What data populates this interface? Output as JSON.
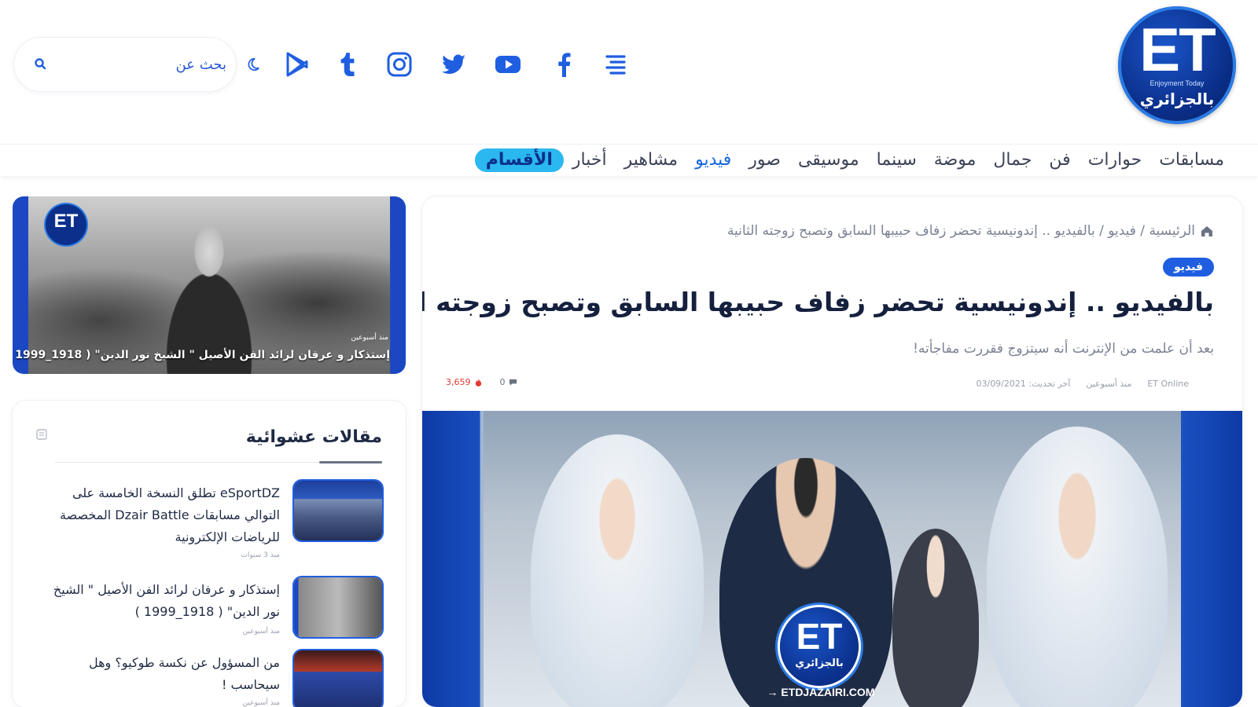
{
  "site": {
    "logo_text": "ET",
    "logo_tagline": "Enjoyment Today",
    "logo_arabic": "بالجزائري"
  },
  "search": {
    "placeholder": "بحث عن"
  },
  "nav": {
    "categories_label": "الأقسام",
    "items": [
      "أخبار",
      "مشاهير",
      "فيديو",
      "صور",
      "موسيقى",
      "سينما",
      "موضة",
      "جمال",
      "فن",
      "حوارات",
      "مسابقات"
    ],
    "active": "فيديو"
  },
  "article": {
    "breadcrumb": "الرئيسية / فيديو / بالفيديو .. إندونيسية تحضر زفاف حبيبها السابق وتصبح زوجته الثانية",
    "badge": "فيديو",
    "title": "بالفيديو .. إندونيسية تحضر زفاف حبيبها السابق وتصبح زوجته الثانية",
    "subtitle": "بعد أن علمت من الإنترنت أنه سيتزوج فقررت مفاجأته!",
    "meta_author": "ET Online",
    "meta_updated": "منذ أسبوعين",
    "meta_date": "آخر تحديث: 03/09/2021",
    "views": "3,659",
    "comments": "0",
    "hero_logo_text": "ET",
    "hero_logo_arabic": "بالجزائري",
    "hero_url": "→ ETDJAZAIRI.COM"
  },
  "banner": {
    "logo_text": "ET",
    "small_label": "منذ أسبوعين",
    "caption": "إستذكار و عرفان لرائد الفن الأصيل \" الشيخ نور الدين\" ( 1918_1999 )"
  },
  "widget": {
    "title": "مقالات عشوائية",
    "posts": [
      {
        "title": "eSportDZ تطلق النسخة الخامسة على التوالي مسابقات Dzair Battle المخصصة للرياضات الإلكترونية",
        "author": "منذ 3 سنوات"
      },
      {
        "title": "إستذكار و عرفان لرائد الفن الأصيل \" الشيخ نور الدين\" ( 1918_1999 )",
        "author": "منذ أسبوعين"
      },
      {
        "title": "من المسؤول عن نكسة طوكيو؟ وهل سيحاسب !",
        "author": "منذ أسبوعين"
      }
    ]
  },
  "colors": {
    "brand_blue": "#0b2f8a",
    "accent_blue": "#1769e0",
    "nav_highlight": "#2bb7f0",
    "views_red": "#e53935"
  },
  "icons": [
    "menu-icon",
    "facebook-icon",
    "youtube-icon",
    "twitter-icon",
    "instagram-icon",
    "tumblr-icon",
    "google-play-icon",
    "moon-icon",
    "search-icon",
    "home-icon",
    "eye-icon",
    "comment-icon",
    "rss-icon"
  ]
}
